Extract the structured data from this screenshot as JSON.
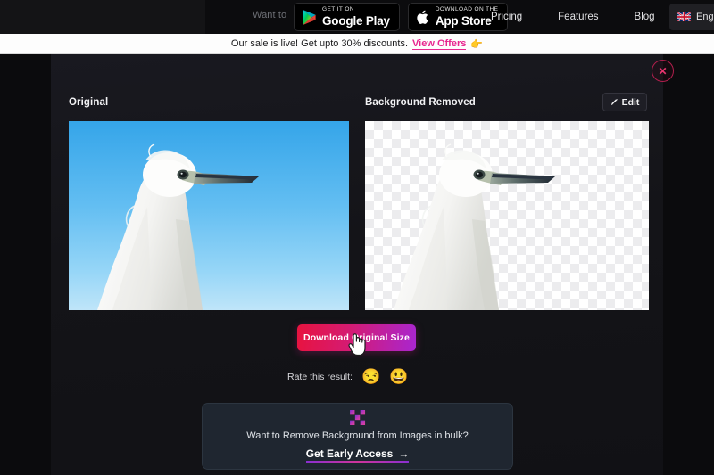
{
  "nav": {
    "promo_text": "Want to",
    "store_badges": [
      {
        "icon": "google-play-icon",
        "top_label": "GET IT ON",
        "main_label": "Google Play"
      },
      {
        "icon": "apple-icon",
        "top_label": "Download on the",
        "main_label": "App Store"
      }
    ],
    "links": [
      {
        "label": "Pricing"
      },
      {
        "label": "Features"
      },
      {
        "label": "Blog"
      }
    ],
    "language": {
      "icon": "uk-flag-icon",
      "label": "English"
    }
  },
  "sale_banner": {
    "text": "Our sale is live! Get upto 30% discounts.",
    "link_label": "View Offers",
    "emoji": "👉"
  },
  "modal": {
    "close_icon": "close-icon",
    "original": {
      "label": "Original"
    },
    "removed": {
      "label": "Background Removed",
      "edit_button": {
        "label": "Edit",
        "icon": "pencil-icon"
      }
    },
    "download_button": {
      "label": "Download Original Size"
    },
    "rate": {
      "label": "Rate this result:",
      "options": [
        {
          "name": "sad-face",
          "glyph": "😒"
        },
        {
          "name": "happy-face",
          "glyph": "😃"
        }
      ]
    },
    "bulk_card": {
      "logo": "bulk-x-logo",
      "text": "Want to Remove Background from Images in bulk?",
      "cta_label": "Get Early Access",
      "cta_arrow": "→"
    }
  },
  "colors": {
    "accent_pink": "#e8268f",
    "download_gradient_start": "#e8133f",
    "download_gradient_end": "#a926cf",
    "close_red": "#e8356f",
    "sky_blue": "#63bef2",
    "modal_bg": "#16161b",
    "page_bg": "#0b0b0d",
    "bulk_card_bg": "#1f2630"
  }
}
